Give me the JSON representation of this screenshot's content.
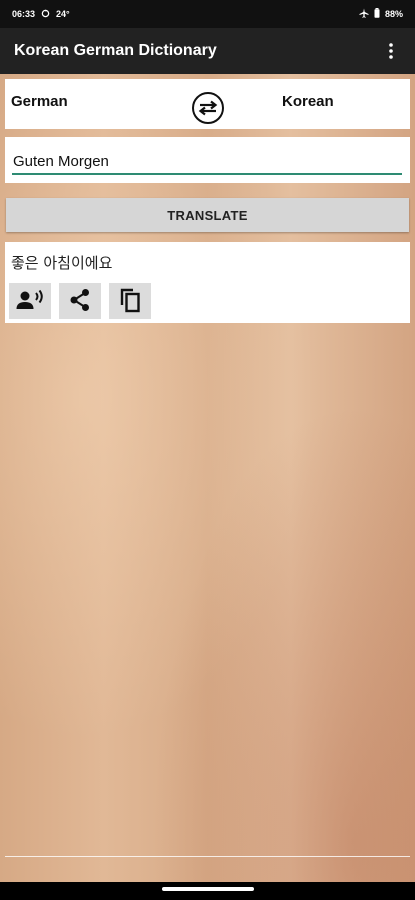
{
  "status_bar": {
    "time": "06:33",
    "temperature": "24°",
    "battery": "88%",
    "icons": [
      "sync-icon",
      "airplane-icon",
      "battery-icon"
    ]
  },
  "app_bar": {
    "title": "Korean German Dictionary",
    "menu_icon": "more-vert-icon"
  },
  "languages": {
    "from": "German",
    "to": "Korean",
    "swap_icon": "swap-icon"
  },
  "input": {
    "value": "Guten Morgen"
  },
  "translate_button": {
    "label": "TRANSLATE"
  },
  "result": {
    "text": "좋은 아침이에요",
    "actions": [
      "speaker-icon",
      "share-icon",
      "copy-icon"
    ]
  },
  "colors": {
    "app_bar": "#222222",
    "input_underline": "#2e8b73",
    "button_bg": "#d6d6d6",
    "background_wood": "#dcae8b"
  }
}
